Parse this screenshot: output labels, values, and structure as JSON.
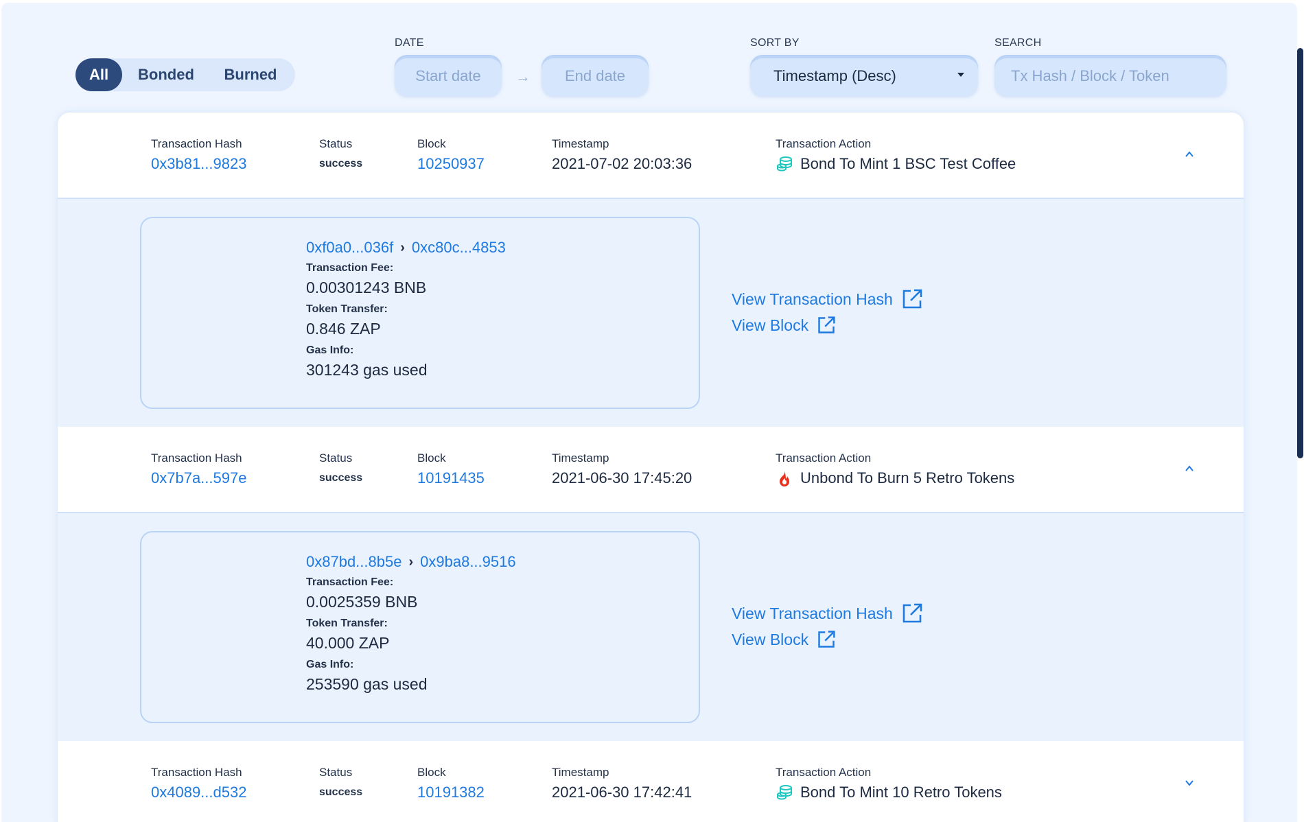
{
  "filters": {
    "toggles": [
      {
        "label": "All",
        "active": true
      },
      {
        "label": "Bonded",
        "active": false
      },
      {
        "label": "Burned",
        "active": false
      }
    ],
    "date_label": "DATE",
    "start_date_placeholder": "Start date",
    "end_date_placeholder": "End date",
    "date_separator": "→",
    "sort_label": "SORT BY",
    "sort_value": "Timestamp (Desc)",
    "search_label": "SEARCH",
    "search_placeholder": "Tx Hash / Block / Token"
  },
  "column_labels": {
    "hash": "Transaction Hash",
    "status": "Status",
    "block": "Block",
    "timestamp": "Timestamp",
    "action": "Transaction Action"
  },
  "detail_labels": {
    "fee": "Transaction Fee:",
    "transfer": "Token Transfer:",
    "gas": "Gas Info:",
    "view_hash": "View Transaction Hash",
    "view_block": "View Block"
  },
  "transactions": [
    {
      "hash": "0x3b81...9823",
      "status": "success",
      "block": "10250937",
      "timestamp": "2021-07-02 20:03:36",
      "action": "Bond To Mint 1 BSC Test Coffee",
      "action_icon": "coins-icon",
      "expanded": true,
      "from": "0xf0a0...036f",
      "to": "0xc80c...4853",
      "fee": "0.00301243 BNB",
      "transfer": "0.846 ZAP",
      "gas": "301243 gas used"
    },
    {
      "hash": "0x7b7a...597e",
      "status": "success",
      "block": "10191435",
      "timestamp": "2021-06-30 17:45:20",
      "action": "Unbond To Burn 5 Retro Tokens",
      "action_icon": "fire-icon",
      "expanded": true,
      "from": "0x87bd...8b5e",
      "to": "0x9ba8...9516",
      "fee": "0.0025359 BNB",
      "transfer": "40.000 ZAP",
      "gas": "253590 gas used"
    },
    {
      "hash": "0x4089...d532",
      "status": "success",
      "block": "10191382",
      "timestamp": "2021-06-30 17:42:41",
      "action": "Bond To Mint 10 Retro Tokens",
      "action_icon": "coins-icon",
      "expanded": false
    }
  ],
  "colors": {
    "accent": "#1f7ae0",
    "active_toggle": "#2c4a7c",
    "background": "#eef5ff",
    "coins_icon": "#1ec8c0",
    "fire_icon": "#e8321e"
  }
}
